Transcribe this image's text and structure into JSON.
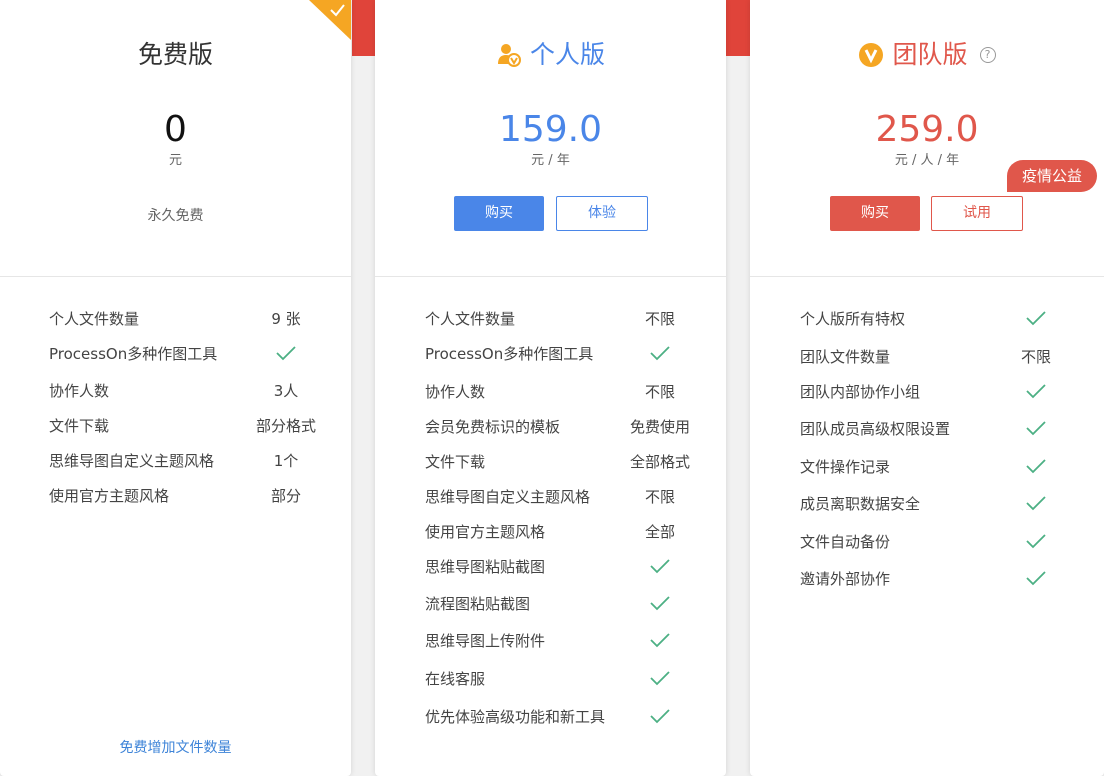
{
  "plans": {
    "free": {
      "name": "免费版",
      "price": "0",
      "unit": "元",
      "note": "永久免费",
      "features": [
        {
          "name": "个人文件数量",
          "value": "9 张"
        },
        {
          "name": "ProcessOn多种作图工具",
          "value": ""
        },
        {
          "name": "协作人数",
          "value": "3人"
        },
        {
          "name": "文件下载",
          "value": "部分格式"
        },
        {
          "name": "思维导图自定义主题风格",
          "value": "1个"
        },
        {
          "name": "使用官方主题风格",
          "value": "部分"
        }
      ],
      "link": "免费增加文件数量"
    },
    "personal": {
      "name": "个人版",
      "price": "159.0",
      "unit": "元 / 年",
      "buy": "购买",
      "trial": "体验",
      "features": [
        {
          "name": "个人文件数量",
          "value": "不限"
        },
        {
          "name": "ProcessOn多种作图工具",
          "value": ""
        },
        {
          "name": "协作人数",
          "value": "不限"
        },
        {
          "name": "会员免费标识的模板",
          "value": "免费使用"
        },
        {
          "name": "文件下载",
          "value": "全部格式"
        },
        {
          "name": "思维导图自定义主题风格",
          "value": "不限"
        },
        {
          "name": "使用官方主题风格",
          "value": "全部"
        },
        {
          "name": "思维导图粘贴截图",
          "value": ""
        },
        {
          "name": "流程图粘贴截图",
          "value": ""
        },
        {
          "name": "思维导图上传附件",
          "value": ""
        },
        {
          "name": "在线客服",
          "value": ""
        },
        {
          "name": "优先体验高级功能和新工具",
          "value": ""
        }
      ]
    },
    "team": {
      "name": "团队版",
      "price": "259.0",
      "unit": "元 / 人 / 年",
      "buy": "购买",
      "trial": "试用",
      "badge": "疫情公益",
      "help": "?",
      "features": [
        {
          "name": "个人版所有特权",
          "value": ""
        },
        {
          "name": "团队文件数量",
          "value": "不限"
        },
        {
          "name": "团队内部协作小组",
          "value": ""
        },
        {
          "name": "团队成员高级权限设置",
          "value": ""
        },
        {
          "name": "文件操作记录",
          "value": ""
        },
        {
          "name": "成员离职数据安全",
          "value": ""
        },
        {
          "name": "文件自动备份",
          "value": ""
        },
        {
          "name": "邀请外部协作",
          "value": ""
        }
      ]
    }
  },
  "colors": {
    "blue": "#4a86e8",
    "red": "#e0574b",
    "orange": "#f5a623",
    "check": "#4cb084",
    "band": "#e0443a"
  },
  "icons": {
    "free_corner": "check-corner-icon",
    "personal": "user-vip-icon",
    "team": "v-circle-icon",
    "check": "check-icon",
    "help": "question-circle-icon"
  }
}
